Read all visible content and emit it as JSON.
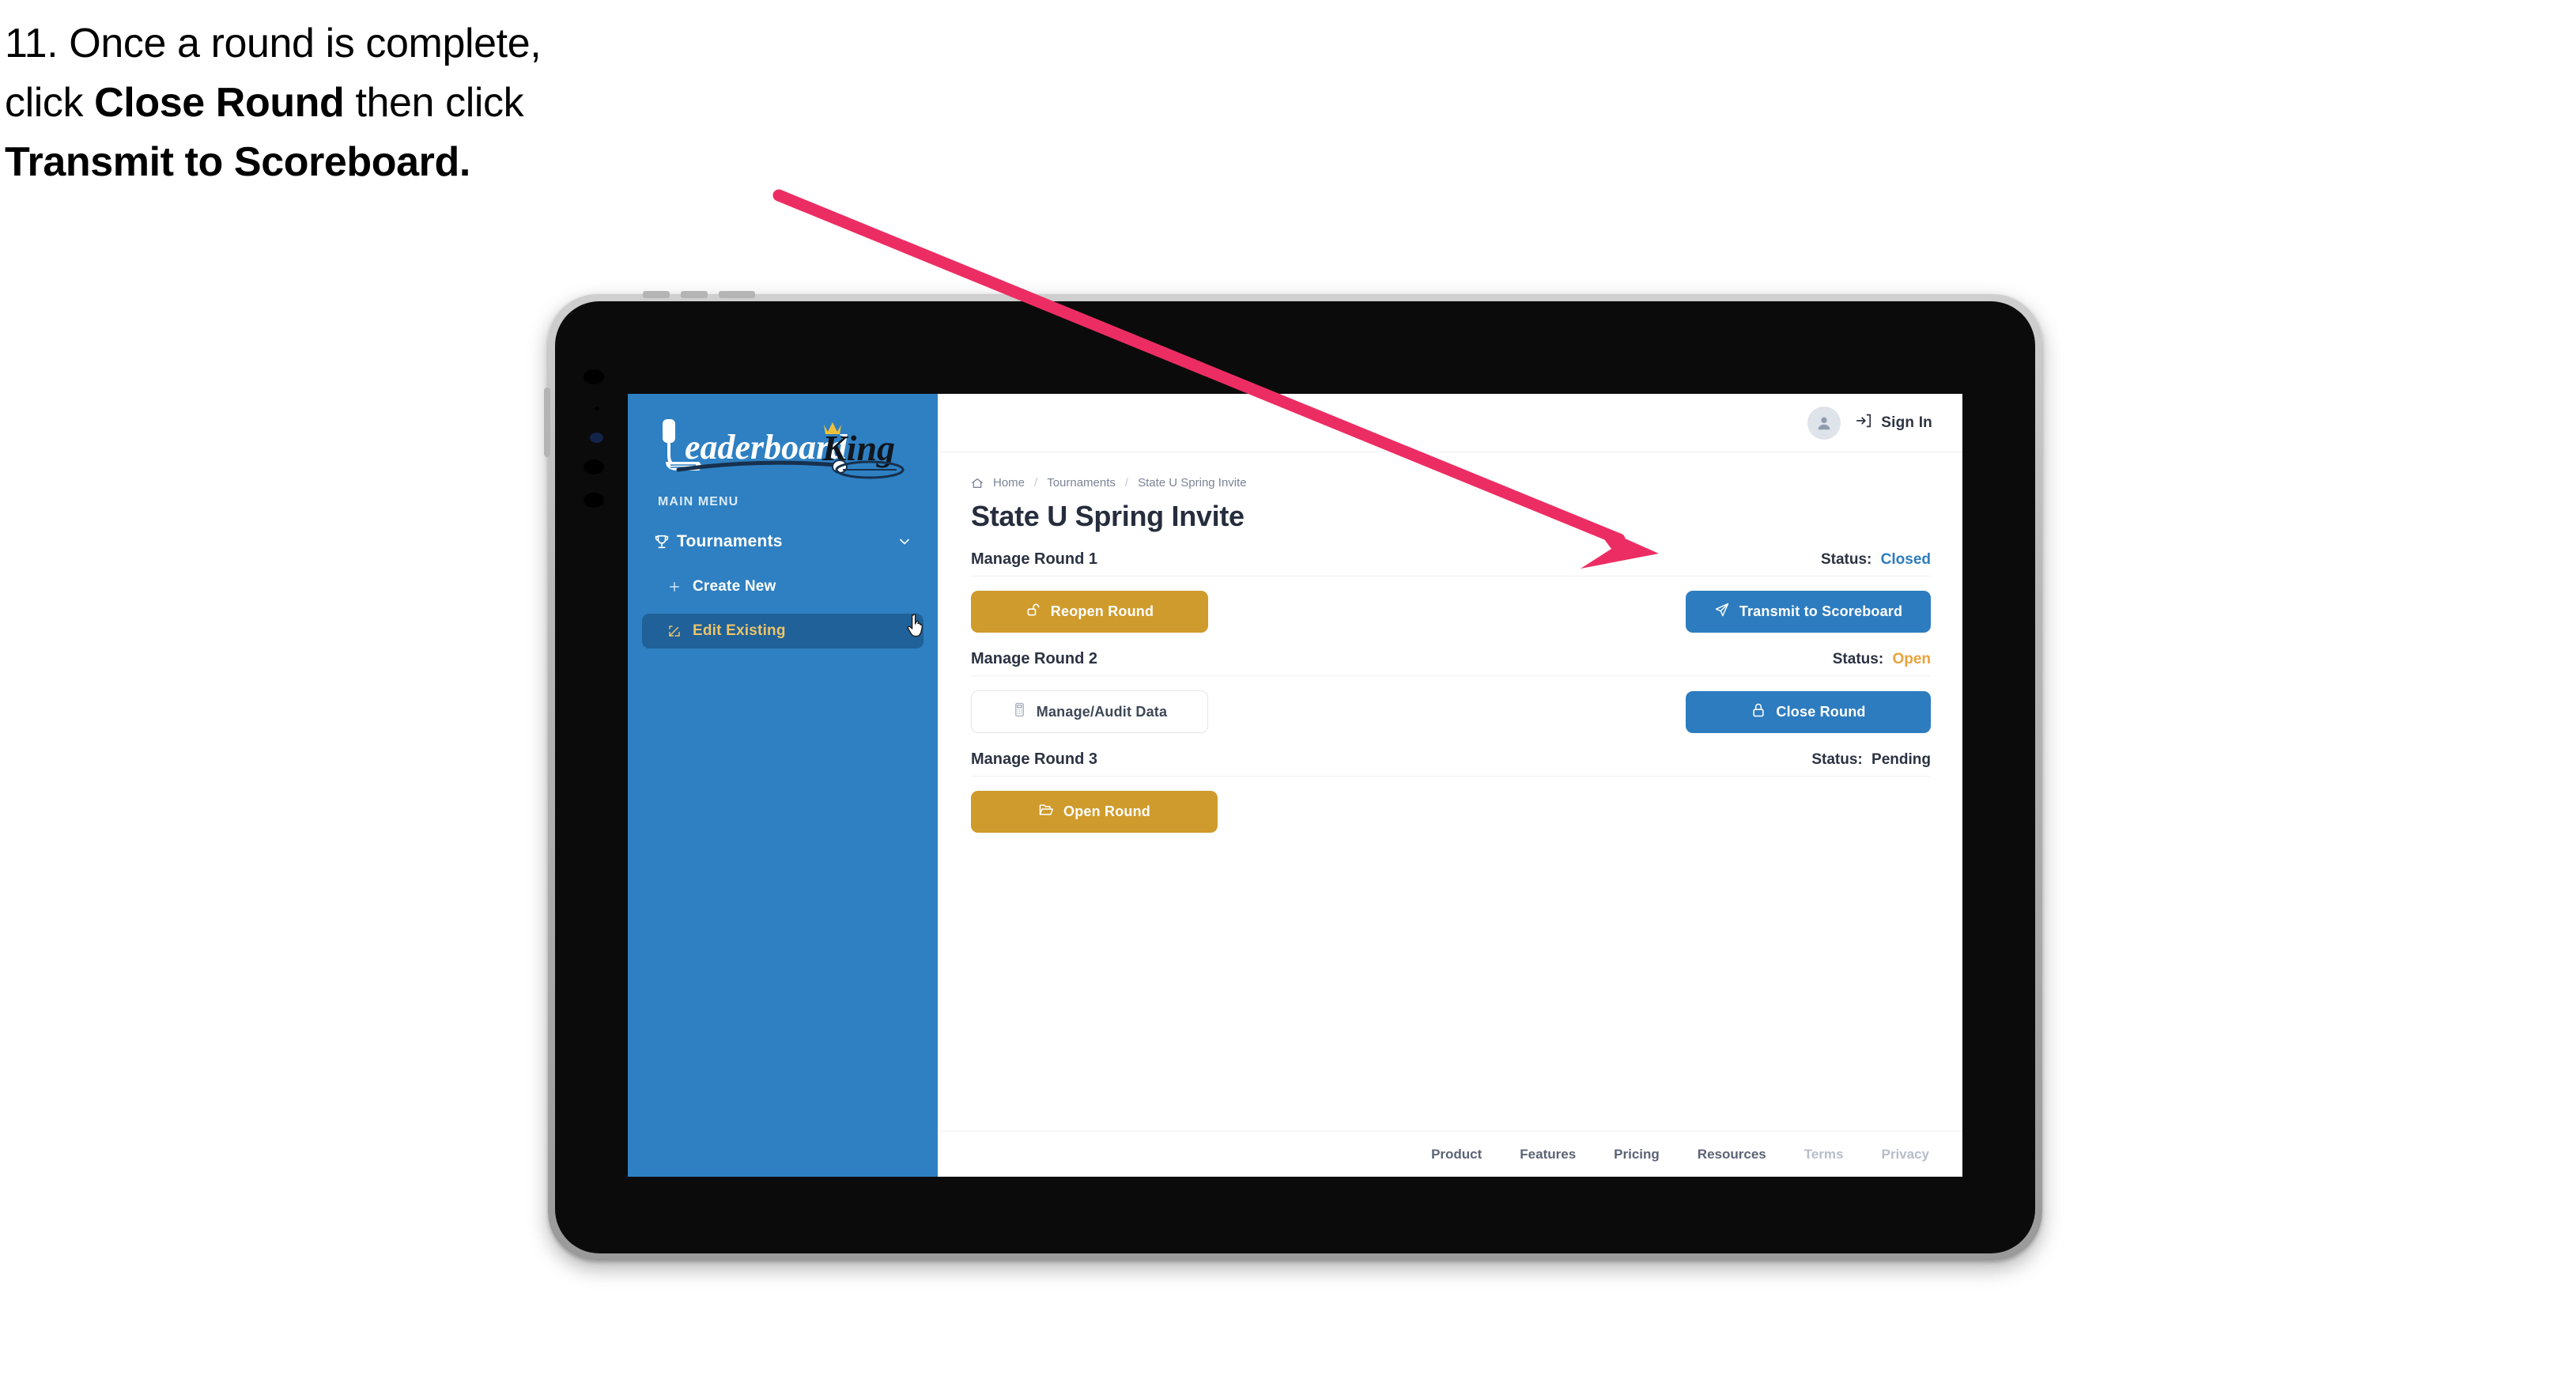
{
  "caption": {
    "line1_plain": "11. Once a round is complete,",
    "line2_pre": "click ",
    "line2_bold": "Close Round",
    "line2_post": " then click",
    "line3_bold": "Transmit to Scoreboard."
  },
  "annotation": {
    "arrow_color": "#ec2d63"
  },
  "sidebar": {
    "logo_text_primary": "Leaderboard",
    "logo_text_secondary": "King",
    "menu_label": "MAIN MENU",
    "items": [
      {
        "label": "Tournaments",
        "icon": "trophy-icon",
        "chevron": "chevron-down-icon",
        "active": false
      },
      {
        "label": "Create New",
        "icon": "plus-icon",
        "active": false
      },
      {
        "label": "Edit Existing",
        "icon": "edit-square-icon",
        "active": true
      }
    ],
    "bg_color": "#2e80c2",
    "active_bg_color": "#1f6198",
    "active_text_color": "#ecc36a"
  },
  "topbar": {
    "avatar_icon": "user-avatar-icon",
    "signin_icon": "login-arrow-icon",
    "signin_label": "Sign In"
  },
  "breadcrumb": {
    "home_icon": "home-icon",
    "items": [
      "Home",
      "Tournaments",
      "State U Spring Invite"
    ],
    "separator": "/"
  },
  "page_title": "State U Spring Invite",
  "rounds": [
    {
      "title": "Manage Round 1",
      "status_label": "Status:",
      "status_value": "Closed",
      "status_color": "#2d7cbf",
      "left_button": {
        "label": "Reopen Round",
        "icon": "unlock-icon",
        "style": "gold"
      },
      "right_button": {
        "label": "Transmit to Scoreboard",
        "icon": "paper-plane-icon",
        "style": "blue"
      }
    },
    {
      "title": "Manage Round 2",
      "status_label": "Status:",
      "status_value": "Open",
      "status_color": "#e8a33d",
      "left_button": {
        "label": "Manage/Audit Data",
        "icon": "calculator-icon",
        "style": "ghost"
      },
      "right_button": {
        "label": "Close Round",
        "icon": "lock-icon",
        "style": "blue"
      }
    },
    {
      "title": "Manage Round 3",
      "status_label": "Status:",
      "status_value": "Pending",
      "status_color": "#2b3242",
      "left_button": {
        "label": "Open Round",
        "icon": "open-folder-icon",
        "style": "gold"
      },
      "right_button": null
    }
  ],
  "footer": {
    "links": [
      {
        "label": "Product",
        "muted": false
      },
      {
        "label": "Features",
        "muted": false
      },
      {
        "label": "Pricing",
        "muted": false
      },
      {
        "label": "Resources",
        "muted": false
      },
      {
        "label": "Terms",
        "muted": true
      },
      {
        "label": "Privacy",
        "muted": true
      }
    ]
  },
  "cursor": {
    "type": "pointing-hand-cursor"
  }
}
